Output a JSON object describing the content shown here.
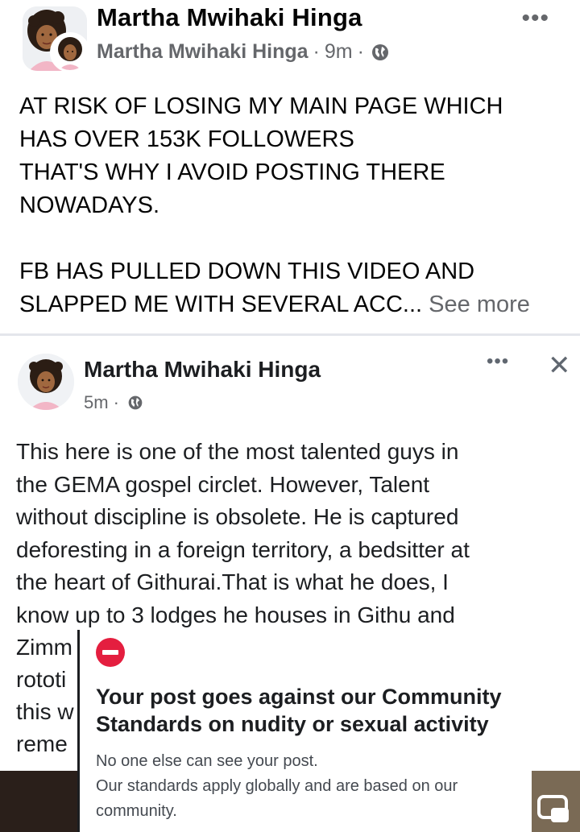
{
  "post": {
    "author": "Martha Mwihaki Hinga",
    "sub_author": "Martha Mwihaki Hinga",
    "time": "9m",
    "dot": "·",
    "more": "•••",
    "lines": [
      "AT RISK OF LOSING MY MAIN PAGE WHICH",
      "HAS OVER 153K FOLLOWERS",
      "THAT'S WHY I AVOID POSTING THERE",
      "NOWADAYS.",
      "FB HAS PULLED DOWN THIS VIDEO AND",
      "SLAPPED ME WITH SEVERAL ACC..."
    ],
    "see_more": "See more"
  },
  "embedded": {
    "author": "Martha Mwihaki Hinga",
    "time": "5m",
    "dot": "·",
    "more": "•••",
    "close": "✕",
    "lines": [
      "This here is one of the most talented guys in",
      "the GEMA gospel circlet. However, Talent",
      "without discipline is obsolete. He is captured",
      "deforesting in a foreign territory, a bedsitter at",
      "the heart of Githurai.That is what he does, I",
      "know up to 3 lodges he houses in Githu and"
    ],
    "partial_lines": [
      "Zimm",
      "rototi",
      "this w",
      "reme"
    ]
  },
  "notice": {
    "title_lines": [
      "Your post goes against our Community",
      "Standards on nudity or sexual activity"
    ],
    "body_lines": [
      "No one else can see your post.",
      "Our standards apply globally and are based on our",
      "community."
    ]
  },
  "icons": {
    "globe": "globe-icon",
    "prohibited": "prohibited-icon",
    "pip": "picture-in-picture-icon"
  },
  "colors": {
    "text": "#050505",
    "muted": "#65676b",
    "alert": "#e41e3f"
  }
}
